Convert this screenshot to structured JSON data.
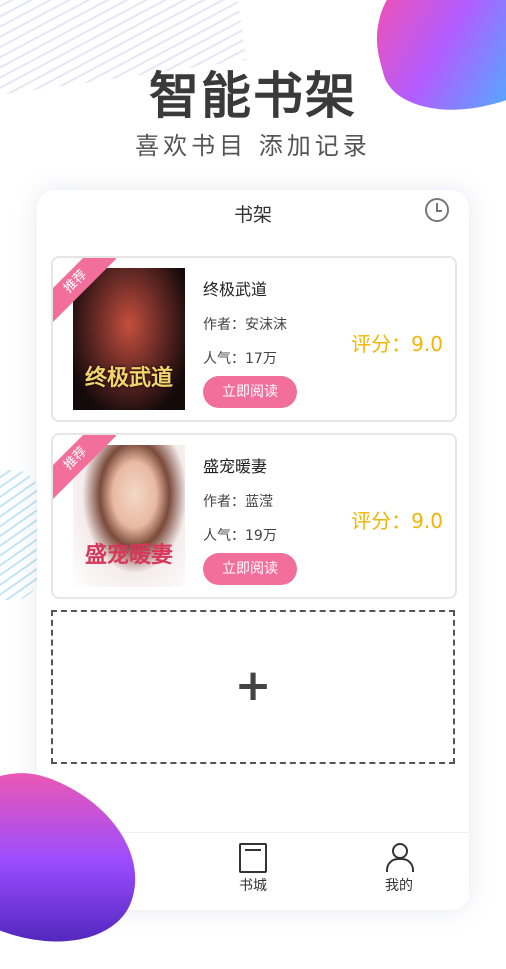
{
  "header": {
    "headline": "智能书架",
    "subline": "喜欢书目 添加记录"
  },
  "screen": {
    "title": "书架",
    "history_icon": "clock-icon"
  },
  "books": [
    {
      "badge": "推荐",
      "title": "终极武道",
      "author": "作者：安沫沫",
      "popularity": "人气：17万",
      "button": "立即阅读",
      "score": "评分：9.0",
      "cover_text": "终极武道"
    },
    {
      "badge": "推荐",
      "title": "盛宠暖妻",
      "author": "作者：蓝滢",
      "popularity": "人气：19万",
      "button": "立即阅读",
      "score": "评分：9.0",
      "cover_text": "盛宠暖妻"
    }
  ],
  "add_slot": {
    "symbol": "+"
  },
  "tabbar": {
    "items": [
      {
        "label": "",
        "icon": "bookshelf-icon"
      },
      {
        "label": "书城",
        "icon": "book-icon"
      },
      {
        "label": "我的",
        "icon": "user-icon"
      }
    ]
  },
  "colors": {
    "accent_pink": "#f36f9b",
    "score_yellow": "#f5b400"
  }
}
